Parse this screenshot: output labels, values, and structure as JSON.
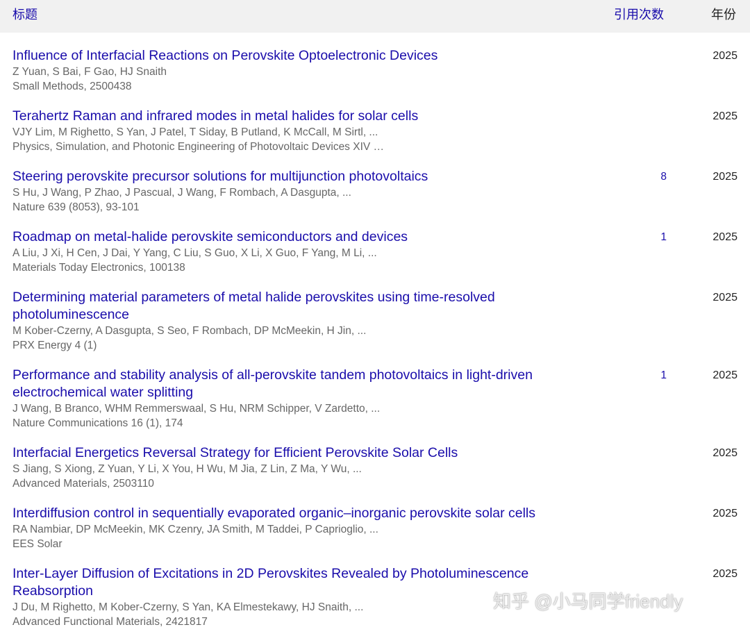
{
  "header": {
    "title_col": "标题",
    "cited_col": "引用次数",
    "year_col": "年份"
  },
  "papers": [
    {
      "title": "Influence of Interfacial Reactions on Perovskite Optoelectronic Devices",
      "authors": "Z Yuan, S Bai, F Gao, HJ Snaith",
      "venue": "Small Methods, 2500438",
      "cited": "",
      "year": "2025"
    },
    {
      "title": "Terahertz Raman and infrared modes in metal halides for solar cells",
      "authors": "VJY Lim, M Righetto, S Yan, J Patel, T Siday, B Putland, K McCall, M Sirtl, ...",
      "venue": "Physics, Simulation, and Photonic Engineering of Photovoltaic Devices XIV …",
      "cited": "",
      "year": "2025"
    },
    {
      "title": "Steering perovskite precursor solutions for multijunction photovoltaics",
      "authors": "S Hu, J Wang, P Zhao, J Pascual, J Wang, F Rombach, A Dasgupta, ...",
      "venue": "Nature 639 (8053), 93-101",
      "cited": "8",
      "year": "2025"
    },
    {
      "title": "Roadmap on metal-halide perovskite semiconductors and devices",
      "authors": "A Liu, J Xi, H Cen, J Dai, Y Yang, C Liu, S Guo, X Li, X Guo, F Yang, M Li, ...",
      "venue": "Materials Today Electronics, 100138",
      "cited": "1",
      "year": "2025"
    },
    {
      "title": "Determining material parameters of metal halide perovskites using time-resolved photoluminescence",
      "authors": "M Kober-Czerny, A Dasgupta, S Seo, F Rombach, DP McMeekin, H Jin, ...",
      "venue": "PRX Energy 4 (1)",
      "cited": "",
      "year": "2025"
    },
    {
      "title": "Performance and stability analysis of all-perovskite tandem photovoltaics in light-driven electrochemical water splitting",
      "authors": "J Wang, B Branco, WHM Remmerswaal, S Hu, NRM Schipper, V Zardetto, ...",
      "venue": "Nature Communications 16 (1), 174",
      "cited": "1",
      "year": "2025"
    },
    {
      "title": "Interfacial Energetics Reversal Strategy for Efficient Perovskite Solar Cells",
      "authors": "S Jiang, S Xiong, Z Yuan, Y Li, X You, H Wu, M Jia, Z Lin, Z Ma, Y Wu, ...",
      "venue": "Advanced Materials, 2503110",
      "cited": "",
      "year": "2025"
    },
    {
      "title": "Interdiffusion control in sequentially evaporated organic–inorganic perovskite solar cells",
      "authors": "RA Nambiar, DP McMeekin, MK Czenry, JA Smith, M Taddei, P Caprioglio, ...",
      "venue": "EES Solar",
      "cited": "",
      "year": "2025"
    },
    {
      "title": "Inter‐Layer Diffusion of Excitations in 2D Perovskites Revealed by Photoluminescence Reabsorption",
      "authors": "J Du, M Righetto, M Kober‐Czerny, S Yan, KA Elmestekawy, HJ Snaith, ...",
      "venue": "Advanced Functional Materials, 2421817",
      "cited": "",
      "year": "2025"
    }
  ],
  "watermark": "知乎 @小马同学friendly"
}
